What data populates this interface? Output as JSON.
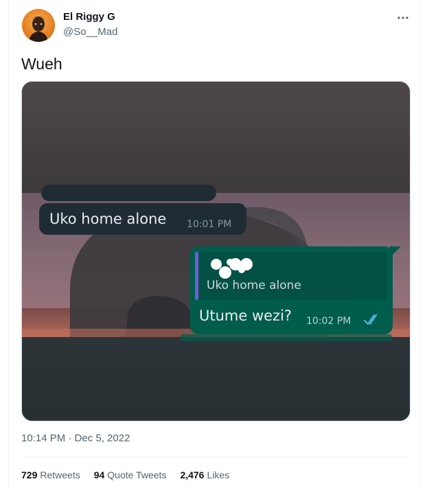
{
  "author": {
    "display_name": "El Riggy G",
    "handle": "@So__Mad",
    "avatar_icon": "avatar-image"
  },
  "more_icon": "more-horizontal-icon",
  "tweet": {
    "text": "Wueh",
    "timestamp": "10:14 PM · Dec 5, 2022"
  },
  "media": {
    "chat": {
      "received": {
        "text": "Uko home alone",
        "time": "10:01 PM"
      },
      "sent": {
        "quoted_text": "Uko home alone",
        "text": "Utume wezi?",
        "time": "10:02 PM",
        "status_icon": "double-check-icon"
      }
    },
    "colors": {
      "received_bubble": "#1f2c34",
      "sent_bubble": "#005c4b",
      "quote_bar": "#6d5dd3",
      "read_ticks": "#53bdeb"
    }
  },
  "stats": {
    "retweets": {
      "count": "729",
      "label": "Retweets"
    },
    "quote_tweets": {
      "count": "94",
      "label": "Quote Tweets"
    },
    "likes": {
      "count": "2,476",
      "label": "Likes"
    }
  }
}
